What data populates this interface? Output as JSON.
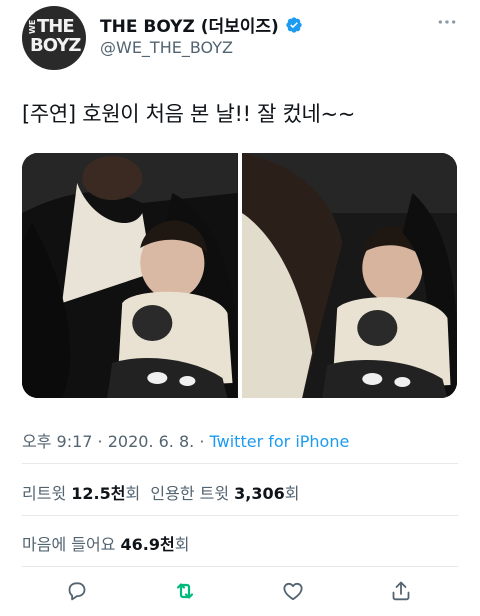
{
  "tweet": {
    "display_name": "THE BOYZ (더보이즈)",
    "handle": "@WE_THE_BOYZ",
    "avatar_logo": {
      "small": "WE",
      "line1": "THE",
      "line2": "BOYZ"
    },
    "text": "[주연] 호원이 처음 본 날!! 잘 컸네~~",
    "time": "오후 9:17",
    "separator": " · ",
    "date": "2020. 6. 8.",
    "source": "Twitter for iPhone",
    "retweets_label": "리트윗",
    "retweets_value": "12.5천",
    "retweets_unit": "회",
    "quotes_label": "인용한 트윗",
    "quotes_value": "3,306",
    "quotes_unit": "회",
    "likes_label": "마음에 들어요",
    "likes_value": "46.9천",
    "likes_unit": "회"
  },
  "icons": {
    "verified": "verified-badge-icon",
    "more": "more-dots-icon",
    "reply": "reply-icon",
    "retweet": "retweet-icon",
    "like": "heart-icon",
    "share": "share-icon"
  },
  "colors": {
    "accent": "#1d9bf0",
    "retweeted": "#00ba7c",
    "text": "#0f1419",
    "secondary": "#536471",
    "divider": "#e6e9ec"
  }
}
